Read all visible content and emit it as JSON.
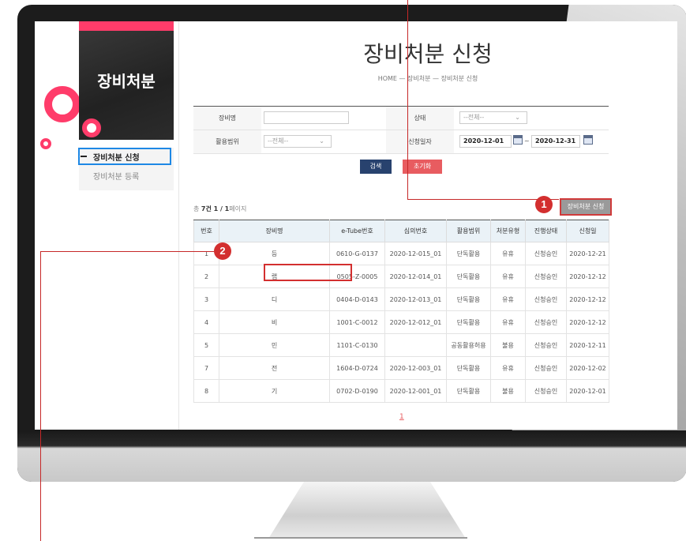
{
  "sidebar": {
    "title": "장비처분",
    "items": [
      {
        "label": "장비처분 신청",
        "active": true
      },
      {
        "label": "장비처분 등록",
        "active": false
      }
    ]
  },
  "header": {
    "title": "장비처분 신청",
    "breadcrumb": "HOME  —  장비처분  —  장비처분 신청"
  },
  "search": {
    "name_label": "장비명",
    "name_value": "",
    "status_label": "상태",
    "status_value": "--전체--",
    "usage_label": "활용범위",
    "usage_value": "--전체--",
    "date_label": "신청일자",
    "date_from": "2020-12-01",
    "date_sep": "~",
    "date_to": "2020-12-31",
    "search_button": "검색",
    "reset_button": "초기화"
  },
  "list": {
    "summary_prefix": "총 ",
    "summary_count": "7건 1 / 1",
    "summary_suffix": "페이지",
    "apply_button": "장비처분 신청",
    "columns": [
      "번호",
      "장비명",
      "e-Tube번호",
      "심의번호",
      "활용범위",
      "처분유형",
      "진행상태",
      "신청일"
    ],
    "rows": [
      [
        "1",
        "등",
        "0610-G-0137",
        "2020-12-015_01",
        "단독활용",
        "유휴",
        "신청승인",
        "2020-12-21"
      ],
      [
        "2",
        "랩",
        "0505-Z-0005",
        "2020-12-014_01",
        "단독활용",
        "유휴",
        "신청승인",
        "2020-12-12"
      ],
      [
        "3",
        "디",
        "0404-D-0143",
        "2020-12-013_01",
        "단독활용",
        "유휴",
        "신청승인",
        "2020-12-12"
      ],
      [
        "4",
        "비",
        "1001-C-0012",
        "2020-12-012_01",
        "단독활용",
        "유휴",
        "신청승인",
        "2020-12-12"
      ],
      [
        "5",
        "민",
        "1101-C-0130",
        "",
        "공동활용허용",
        "불용",
        "신청승인",
        "2020-12-11"
      ],
      [
        "7",
        "전",
        "1604-D-0724",
        "2020-12-003_01",
        "단독활용",
        "유휴",
        "신청승인",
        "2020-12-02"
      ],
      [
        "8",
        "기",
        "0702-D-0190",
        "2020-12-001_01",
        "단독활용",
        "불용",
        "신청승인",
        "2020-12-01"
      ]
    ],
    "page": "1"
  },
  "annotations": {
    "badge1": "1",
    "badge2": "2",
    "color": "#d32f2f"
  }
}
